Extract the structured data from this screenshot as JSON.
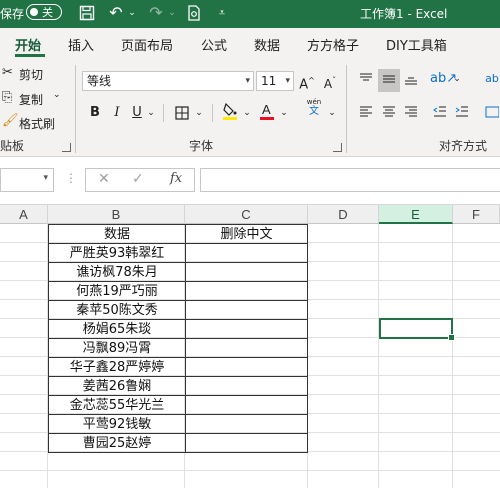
{
  "titlebar": {
    "autosave_label": "保存",
    "autosave_toggle": "关",
    "title": "工作簿1 - Excel"
  },
  "tabs": [
    "开始",
    "插入",
    "页面布局",
    "公式",
    "数据",
    "方方格子",
    "DIY工具箱"
  ],
  "ribbon": {
    "clipboard": {
      "cut": "剪切",
      "copy": "复制",
      "format_painter": "格式刷",
      "group_label": "贴板"
    },
    "font": {
      "font_name": "等线",
      "font_size": "11",
      "grow": "A^",
      "shrink": "A˅",
      "bold": "B",
      "italic": "I",
      "underline": "U",
      "phonetic": "wén",
      "group_label": "字体"
    },
    "alignment": {
      "group_label": "对齐方式"
    }
  },
  "formula_bar": {
    "name_box": "",
    "cancel": "✕",
    "enter": "✓",
    "fx": "fx",
    "value": ""
  },
  "columns": [
    "A",
    "B",
    "C",
    "D",
    "E",
    "F"
  ],
  "active_column": "E",
  "table": {
    "headers": [
      "数据",
      "删除中文"
    ],
    "rows": [
      [
        "严胜英93韩翠红",
        ""
      ],
      [
        "谯访枫78朱月",
        ""
      ],
      [
        "何燕19严巧丽",
        ""
      ],
      [
        "秦苹50陈文秀",
        ""
      ],
      [
        "杨娟65朱琰",
        ""
      ],
      [
        "冯飘89冯霄",
        ""
      ],
      [
        "华子鑫28严婷婷",
        ""
      ],
      [
        "姜茜26鲁娴",
        ""
      ],
      [
        "金芯蕊55华光兰",
        ""
      ],
      [
        "平莺92钱敏",
        ""
      ],
      [
        "曹园25赵婷",
        ""
      ]
    ]
  },
  "colors": {
    "accent": "#217346",
    "ribbon_bg": "#f3f2f1",
    "header_bg": "#efefef"
  }
}
